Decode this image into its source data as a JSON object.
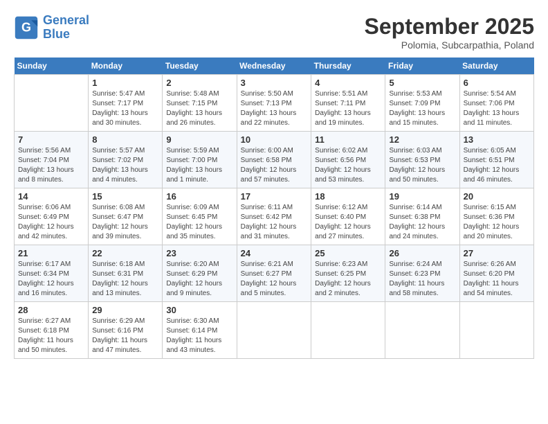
{
  "header": {
    "logo_line1": "General",
    "logo_line2": "Blue",
    "month": "September 2025",
    "location": "Polomia, Subcarpathia, Poland"
  },
  "weekdays": [
    "Sunday",
    "Monday",
    "Tuesday",
    "Wednesday",
    "Thursday",
    "Friday",
    "Saturday"
  ],
  "weeks": [
    [
      {
        "day": "",
        "info": ""
      },
      {
        "day": "1",
        "info": "Sunrise: 5:47 AM\nSunset: 7:17 PM\nDaylight: 13 hours\nand 30 minutes."
      },
      {
        "day": "2",
        "info": "Sunrise: 5:48 AM\nSunset: 7:15 PM\nDaylight: 13 hours\nand 26 minutes."
      },
      {
        "day": "3",
        "info": "Sunrise: 5:50 AM\nSunset: 7:13 PM\nDaylight: 13 hours\nand 22 minutes."
      },
      {
        "day": "4",
        "info": "Sunrise: 5:51 AM\nSunset: 7:11 PM\nDaylight: 13 hours\nand 19 minutes."
      },
      {
        "day": "5",
        "info": "Sunrise: 5:53 AM\nSunset: 7:09 PM\nDaylight: 13 hours\nand 15 minutes."
      },
      {
        "day": "6",
        "info": "Sunrise: 5:54 AM\nSunset: 7:06 PM\nDaylight: 13 hours\nand 11 minutes."
      }
    ],
    [
      {
        "day": "7",
        "info": "Sunrise: 5:56 AM\nSunset: 7:04 PM\nDaylight: 13 hours\nand 8 minutes."
      },
      {
        "day": "8",
        "info": "Sunrise: 5:57 AM\nSunset: 7:02 PM\nDaylight: 13 hours\nand 4 minutes."
      },
      {
        "day": "9",
        "info": "Sunrise: 5:59 AM\nSunset: 7:00 PM\nDaylight: 13 hours\nand 1 minute."
      },
      {
        "day": "10",
        "info": "Sunrise: 6:00 AM\nSunset: 6:58 PM\nDaylight: 12 hours\nand 57 minutes."
      },
      {
        "day": "11",
        "info": "Sunrise: 6:02 AM\nSunset: 6:56 PM\nDaylight: 12 hours\nand 53 minutes."
      },
      {
        "day": "12",
        "info": "Sunrise: 6:03 AM\nSunset: 6:53 PM\nDaylight: 12 hours\nand 50 minutes."
      },
      {
        "day": "13",
        "info": "Sunrise: 6:05 AM\nSunset: 6:51 PM\nDaylight: 12 hours\nand 46 minutes."
      }
    ],
    [
      {
        "day": "14",
        "info": "Sunrise: 6:06 AM\nSunset: 6:49 PM\nDaylight: 12 hours\nand 42 minutes."
      },
      {
        "day": "15",
        "info": "Sunrise: 6:08 AM\nSunset: 6:47 PM\nDaylight: 12 hours\nand 39 minutes."
      },
      {
        "day": "16",
        "info": "Sunrise: 6:09 AM\nSunset: 6:45 PM\nDaylight: 12 hours\nand 35 minutes."
      },
      {
        "day": "17",
        "info": "Sunrise: 6:11 AM\nSunset: 6:42 PM\nDaylight: 12 hours\nand 31 minutes."
      },
      {
        "day": "18",
        "info": "Sunrise: 6:12 AM\nSunset: 6:40 PM\nDaylight: 12 hours\nand 27 minutes."
      },
      {
        "day": "19",
        "info": "Sunrise: 6:14 AM\nSunset: 6:38 PM\nDaylight: 12 hours\nand 24 minutes."
      },
      {
        "day": "20",
        "info": "Sunrise: 6:15 AM\nSunset: 6:36 PM\nDaylight: 12 hours\nand 20 minutes."
      }
    ],
    [
      {
        "day": "21",
        "info": "Sunrise: 6:17 AM\nSunset: 6:34 PM\nDaylight: 12 hours\nand 16 minutes."
      },
      {
        "day": "22",
        "info": "Sunrise: 6:18 AM\nSunset: 6:31 PM\nDaylight: 12 hours\nand 13 minutes."
      },
      {
        "day": "23",
        "info": "Sunrise: 6:20 AM\nSunset: 6:29 PM\nDaylight: 12 hours\nand 9 minutes."
      },
      {
        "day": "24",
        "info": "Sunrise: 6:21 AM\nSunset: 6:27 PM\nDaylight: 12 hours\nand 5 minutes."
      },
      {
        "day": "25",
        "info": "Sunrise: 6:23 AM\nSunset: 6:25 PM\nDaylight: 12 hours\nand 2 minutes."
      },
      {
        "day": "26",
        "info": "Sunrise: 6:24 AM\nSunset: 6:23 PM\nDaylight: 11 hours\nand 58 minutes."
      },
      {
        "day": "27",
        "info": "Sunrise: 6:26 AM\nSunset: 6:20 PM\nDaylight: 11 hours\nand 54 minutes."
      }
    ],
    [
      {
        "day": "28",
        "info": "Sunrise: 6:27 AM\nSunset: 6:18 PM\nDaylight: 11 hours\nand 50 minutes."
      },
      {
        "day": "29",
        "info": "Sunrise: 6:29 AM\nSunset: 6:16 PM\nDaylight: 11 hours\nand 47 minutes."
      },
      {
        "day": "30",
        "info": "Sunrise: 6:30 AM\nSunset: 6:14 PM\nDaylight: 11 hours\nand 43 minutes."
      },
      {
        "day": "",
        "info": ""
      },
      {
        "day": "",
        "info": ""
      },
      {
        "day": "",
        "info": ""
      },
      {
        "day": "",
        "info": ""
      }
    ]
  ]
}
